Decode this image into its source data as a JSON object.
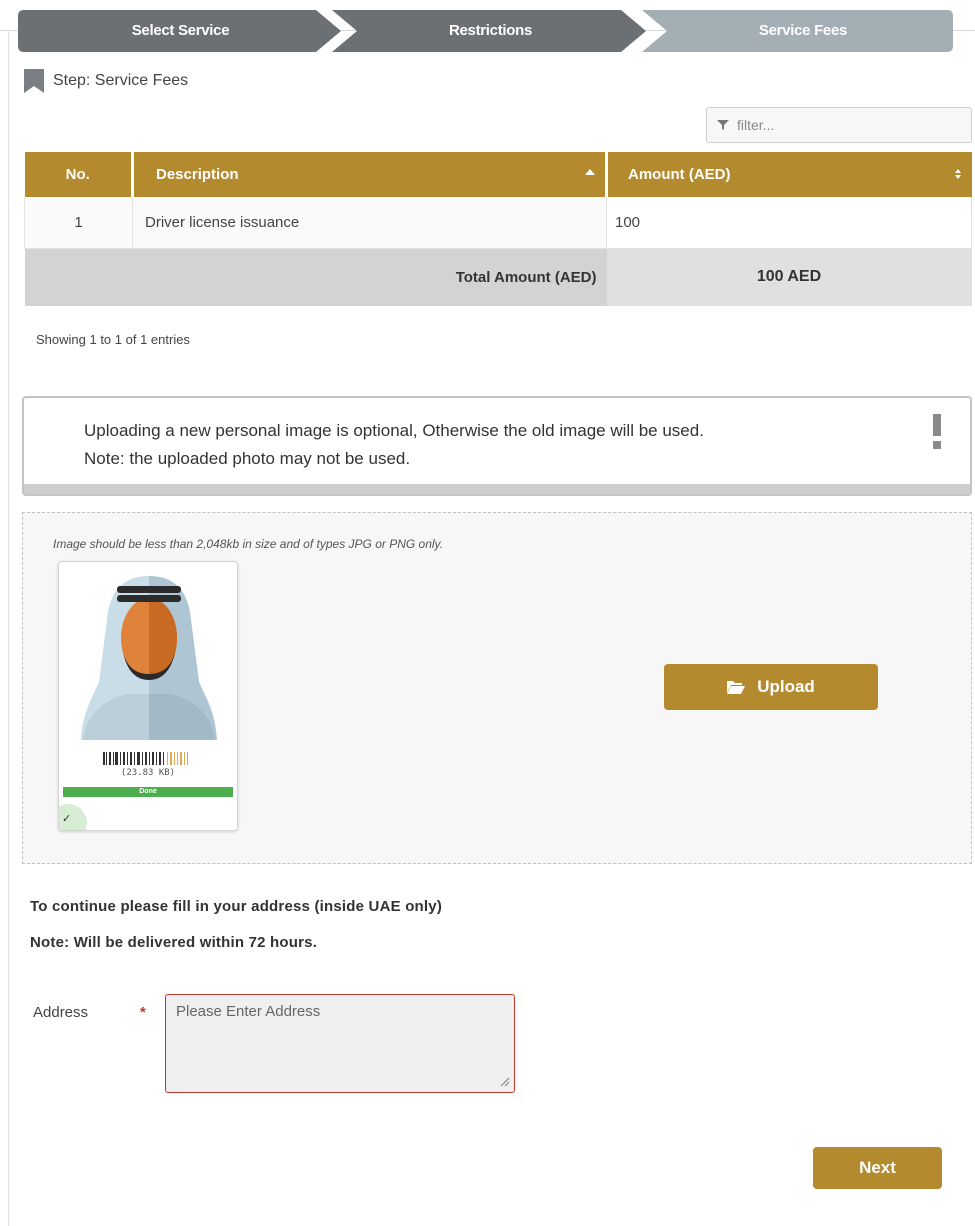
{
  "wizard": {
    "steps": [
      {
        "label": "Select Service",
        "state": "done"
      },
      {
        "label": "Restrictions",
        "state": "done"
      },
      {
        "label": "Service Fees",
        "state": "current"
      }
    ]
  },
  "step_header": {
    "icon": "bookmark-icon",
    "text": "Step: Service Fees"
  },
  "filter": {
    "placeholder": "filter...",
    "icon": "filter-icon"
  },
  "fees_table": {
    "columns": [
      "No.",
      "Description",
      "Amount (AED)"
    ],
    "rows": [
      {
        "no": "1",
        "description": "Driver license issuance",
        "amount": "100"
      }
    ],
    "total_label": "Total Amount (AED)",
    "total_value": "100 AED"
  },
  "showing_text": "Showing 1 to 1 of 1 entries",
  "notice": {
    "line1": "Uploading a new personal image is optional, Otherwise the old image will be used.",
    "line2": "Note: the uploaded photo may not be used.",
    "icon": "exclamation-icon"
  },
  "upload": {
    "hint": "Image should be less than 2,048kb in size and of types JPG or PNG only.",
    "file_size": "(23.83 KB)",
    "progress_label": "Done",
    "progress_percent": 100,
    "button_label": "Upload",
    "button_icon": "folder-open-icon"
  },
  "address": {
    "title": "To continue please fill in your address (inside UAE only)",
    "note": "Note: Will be delivered within 72 hours.",
    "label": "Address",
    "required_mark": "*",
    "placeholder": "Please Enter Address",
    "value": ""
  },
  "next_label": "Next",
  "colors": {
    "accent": "#b38a2e",
    "wizard_done": "#6d7073",
    "wizard_current": "#a3aeb5",
    "progress_green": "#4cae4c",
    "required_red": "#c0392b"
  }
}
